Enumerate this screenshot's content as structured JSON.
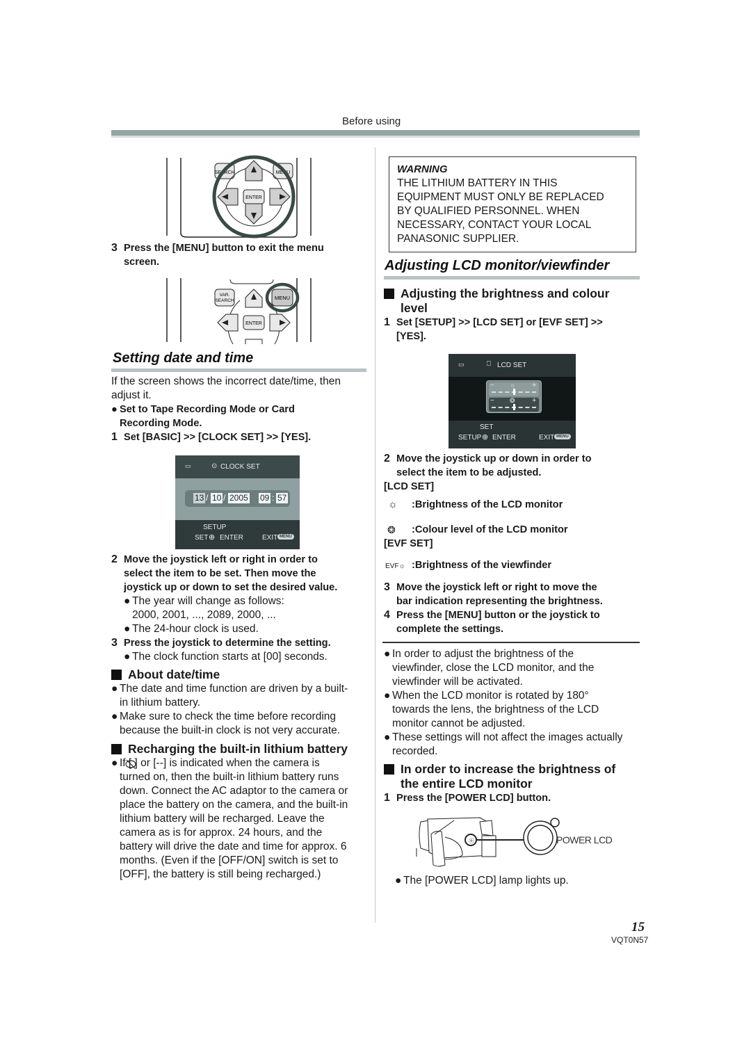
{
  "header": {
    "section": "Before using"
  },
  "left": {
    "illustration_1": {
      "buttons": [
        "VAR. SEARCH",
        "MENU",
        "ENTER"
      ],
      "highlight": "joystick"
    },
    "step_3_exit": {
      "num": "3",
      "lines": [
        "Press the [MENU] button to exit the menu",
        "screen."
      ]
    },
    "illustration_2": {
      "buttons": [
        "VAR.",
        "SEARCH",
        "MENU",
        "ENTER"
      ],
      "highlight": "MENU"
    },
    "setting_date": {
      "title": "Setting date and time",
      "intro": [
        "If the screen shows the incorrect date/time, then",
        "adjust it."
      ],
      "bullet_mode": [
        "Set to Tape Recording Mode or Card",
        "Recording Mode."
      ],
      "step1": {
        "num": "1",
        "text": "Set [BASIC] >> [CLOCK SET] >> [YES]."
      },
      "clock_screen": {
        "title": "CLOCK SET",
        "day": "13",
        "month": "10",
        "year": "2005",
        "hour": "09",
        "minute": "57",
        "sep_date": "/",
        "sep_time": ":",
        "footer_top": "SETUP",
        "footer_set": "SET",
        "footer_enter": "ENTER",
        "footer_exit": "EXIT",
        "menu_pill": "MENU"
      },
      "step2": {
        "num": "2",
        "lines": [
          "Move the joystick left or right in order to",
          "select the item to be set. Then move the",
          "joystick up or down to set the desired value."
        ]
      },
      "step2_bullets": [
        [
          "The year will change as follows:",
          "2000, 2001, ..., 2089, 2000, ..."
        ],
        [
          "The 24-hour clock is used."
        ]
      ],
      "step3": {
        "num": "3",
        "text": "Press the joystick to determine the setting."
      },
      "step3_bullet": "The clock function starts at [00] seconds."
    },
    "about": {
      "title": "About date/time",
      "bullets": [
        [
          "The date and time function are driven by a built-",
          "in lithium battery."
        ],
        [
          "Make sure to check the time before recording",
          "because the built-in clock is not very accurate."
        ]
      ]
    },
    "recharging": {
      "title": "Recharging the built-in lithium battery",
      "lines": [
        "If [  ] or [--] is indicated when the camera is",
        "turned on, then the built-in lithium battery runs",
        "down. Connect the AC adaptor to the camera or",
        "place the battery on the camera, and the built-in",
        "lithium battery will be recharged. Leave the",
        "camera as is for approx. 24 hours, and the",
        "battery will drive the date and time for approx. 6",
        "months. (Even if the [OFF/ON] switch is set to",
        "[OFF], the battery is still being recharged.)"
      ],
      "icon": "clock-battery-warning-icon"
    }
  },
  "right": {
    "warning": {
      "title": "WARNING",
      "lines": [
        "THE LITHIUM BATTERY IN THIS",
        "EQUIPMENT MUST ONLY BE REPLACED",
        "BY QUALIFIED PERSONNEL. WHEN",
        "NECESSARY, CONTACT YOUR LOCAL",
        "PANASONIC SUPPLIER."
      ]
    },
    "adjusting": {
      "title": "Adjusting LCD monitor/viewfinder",
      "sub1": [
        "Adjusting the brightness and colour",
        "level"
      ],
      "step1": {
        "num": "1",
        "lines": [
          "Set [SETUP] >> [LCD SET] or [EVF SET] >>",
          "[YES]."
        ]
      },
      "lcd_screen": {
        "title": "LCD SET",
        "minus": "−",
        "plus": "+",
        "brightness_level": 0.5,
        "colour_level": 0.5,
        "footer_top": "SET",
        "footer_setup": "SETUP",
        "footer_enter": "ENTER",
        "footer_exit": "EXIT",
        "menu_pill": "MENU"
      },
      "step2": {
        "num": "2",
        "lines": [
          "Move the joystick up or down in order to",
          "select the item to be adjusted."
        ]
      },
      "lcd_set_label": "[LCD SET]",
      "lcd_items": [
        {
          "icon": "brightness-icon",
          "text": ":Brightness of the LCD monitor"
        },
        {
          "icon": "colour-icon",
          "text": ":Colour level of the LCD monitor"
        }
      ],
      "evf_set_label": "[EVF SET]",
      "evf_item": {
        "icon": "evf-brightness-icon",
        "prefix": "EVF",
        "text": ":Brightness of the viewfinder"
      },
      "step3": {
        "num": "3",
        "lines": [
          "Move the joystick left or right to move the",
          "bar indication representing the brightness."
        ]
      },
      "step4": {
        "num": "4",
        "lines": [
          "Press the [MENU] button or the joystick to",
          "complete the settings."
        ]
      },
      "notes": [
        [
          "In order to adjust the brightness of the",
          "viewfinder, close the LCD monitor, and the",
          "viewfinder will be activated."
        ],
        [
          "When the LCD monitor is rotated by 180°",
          "towards the lens, the brightness of the LCD",
          "monitor cannot be adjusted."
        ],
        [
          "These settings will not affect the images actually",
          "recorded."
        ]
      ]
    },
    "increase": {
      "title": [
        "In order to increase the brightness of",
        "the entire LCD monitor"
      ],
      "step1": {
        "num": "1",
        "text": "Press the [POWER LCD] button."
      },
      "button_label": "POWER LCD",
      "bullet": "The [POWER LCD] lamp lights up."
    }
  },
  "footer": {
    "page_number": "15",
    "doc_code": "VQT0N57"
  }
}
